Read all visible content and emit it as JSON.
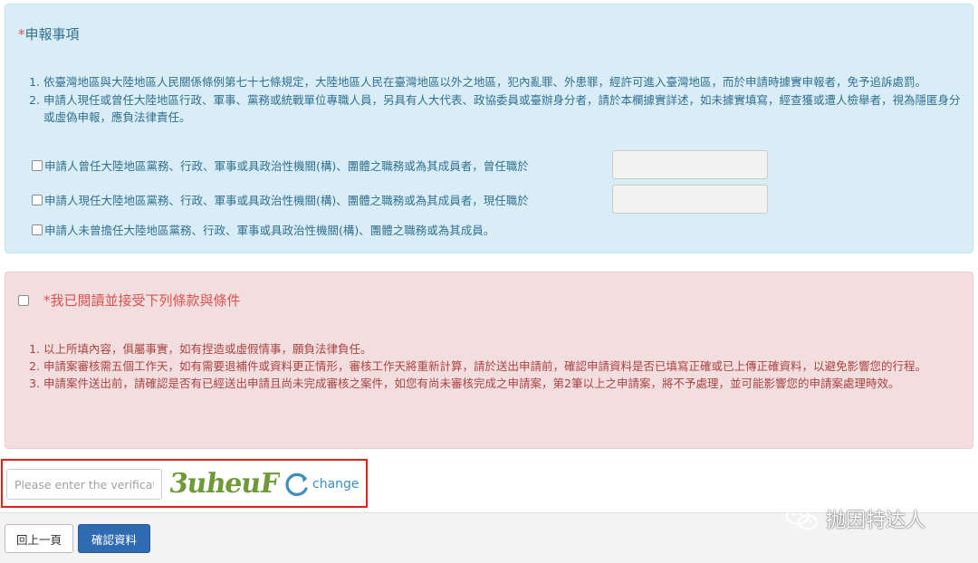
{
  "declaration": {
    "star": "*",
    "title": "申報事項",
    "items": [
      "依臺灣地區與大陸地區人民關係條例第七十七條規定，大陸地區人民在臺灣地區以外之地區，犯內亂罪、外患罪，經許可進入臺灣地區，而於申請時據實申報者，免予追訴處罰。",
      "申請人現任或曾任大陸地區行政、軍事、黨務或統戰單位專職人員，另具有人大代表、政協委員或臺辦身分者，請於本欄據實詳述，如未據實填寫，經查獲或遭人檢舉者，視為隱匿身分或虛偽申報，應負法律責任。"
    ],
    "options": [
      "申請人曾任大陸地區黨務、行政、軍事或具政治性機關(構)、團體之職務或為其成員者，曾任職於",
      "申請人現任大陸地區黨務、行政、軍事或具政治性機關(構)、團體之職務或為其成員者，現任職於",
      "申請人未曾擔任大陸地區黨務、行政、軍事或具政治性機關(構)、團體之職務或為其成員。"
    ]
  },
  "terms": {
    "star": "*",
    "title": "我已閱讀並接受下列條款與條件",
    "items": [
      "以上所填內容，俱屬事實，如有捏造或虛假情事，願負法律負任。",
      "申請案審核需五個工作天，如有需要退補件或資料更正情形，審核工作天將重新計算，請於送出申請前，確認申請資料是否已填寫正確或已上傳正確資料，以避免影響您的行程。",
      "申請案件送出前，請確認是否有已經送出申請且尚未完成審核之案件，如您有尚未審核完成之申請案，第2筆以上之申請案，將不予處理，並可能影響您的申請案處理時效。"
    ]
  },
  "captcha": {
    "placeholder": "Please enter the verification code",
    "code": "3uheuF",
    "change_label": "change"
  },
  "footer": {
    "back_label": "回上一頁",
    "confirm_label": "確認資料"
  },
  "watermark": {
    "text": "抛因特达人"
  },
  "colors": {
    "highlight_border": "#e0201a",
    "primary_button": "#2f6bb0"
  }
}
